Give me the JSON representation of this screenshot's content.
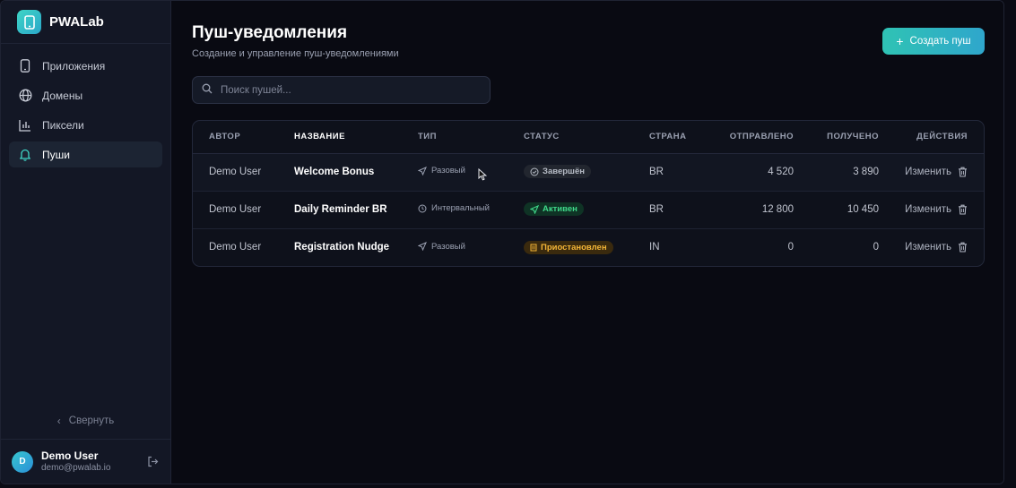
{
  "brand": {
    "name": "PWALab"
  },
  "nav": {
    "items": [
      {
        "label": "Приложения",
        "icon": "smartphone-icon"
      },
      {
        "label": "Домены",
        "icon": "globe-icon"
      },
      {
        "label": "Пиксели",
        "icon": "bar-chart-icon"
      },
      {
        "label": "Пуши",
        "icon": "bell-icon"
      }
    ],
    "active": "Пуши"
  },
  "sidebar": {
    "collapse_label": "Свернуть"
  },
  "user": {
    "initial": "D",
    "name": "Demo User",
    "email": "demo@pwalab.io"
  },
  "page": {
    "title": "Пуш-уведомления",
    "subtitle": "Создание и управление пуш-уведомлениями",
    "create_label": "Создать пуш",
    "search_placeholder": "Поиск пушей..."
  },
  "table": {
    "headers": [
      "АВТОР",
      "НАЗВАНИЕ",
      "ТИП",
      "СТАТУС",
      "СТРАНА",
      "ОТПРАВЛЕНО",
      "ПОЛУЧЕНО",
      "ДЕЙСТВИЯ"
    ],
    "rows": [
      {
        "author": "Demo User",
        "name": "Welcome Bonus",
        "type": "Разовый",
        "status": "Завершён",
        "country": "BR",
        "sent": "4 520",
        "received": "3 890",
        "edit": "Изменить"
      },
      {
        "author": "Demo User",
        "name": "Daily Reminder BR",
        "type": "Интервальный",
        "status": "Активен",
        "country": "BR",
        "sent": "12 800",
        "received": "10 450",
        "edit": "Изменить"
      },
      {
        "author": "Demo User",
        "name": "Registration Nudge",
        "type": "Разовый",
        "status": "Приостановлен",
        "country": "IN",
        "sent": "0",
        "received": "0",
        "edit": "Изменить"
      }
    ]
  },
  "colors": {
    "accent": "#2fc3b4",
    "status_done": "#b7bcc6",
    "status_active": "#3fd98a",
    "status_paused": "#f5b637"
  }
}
